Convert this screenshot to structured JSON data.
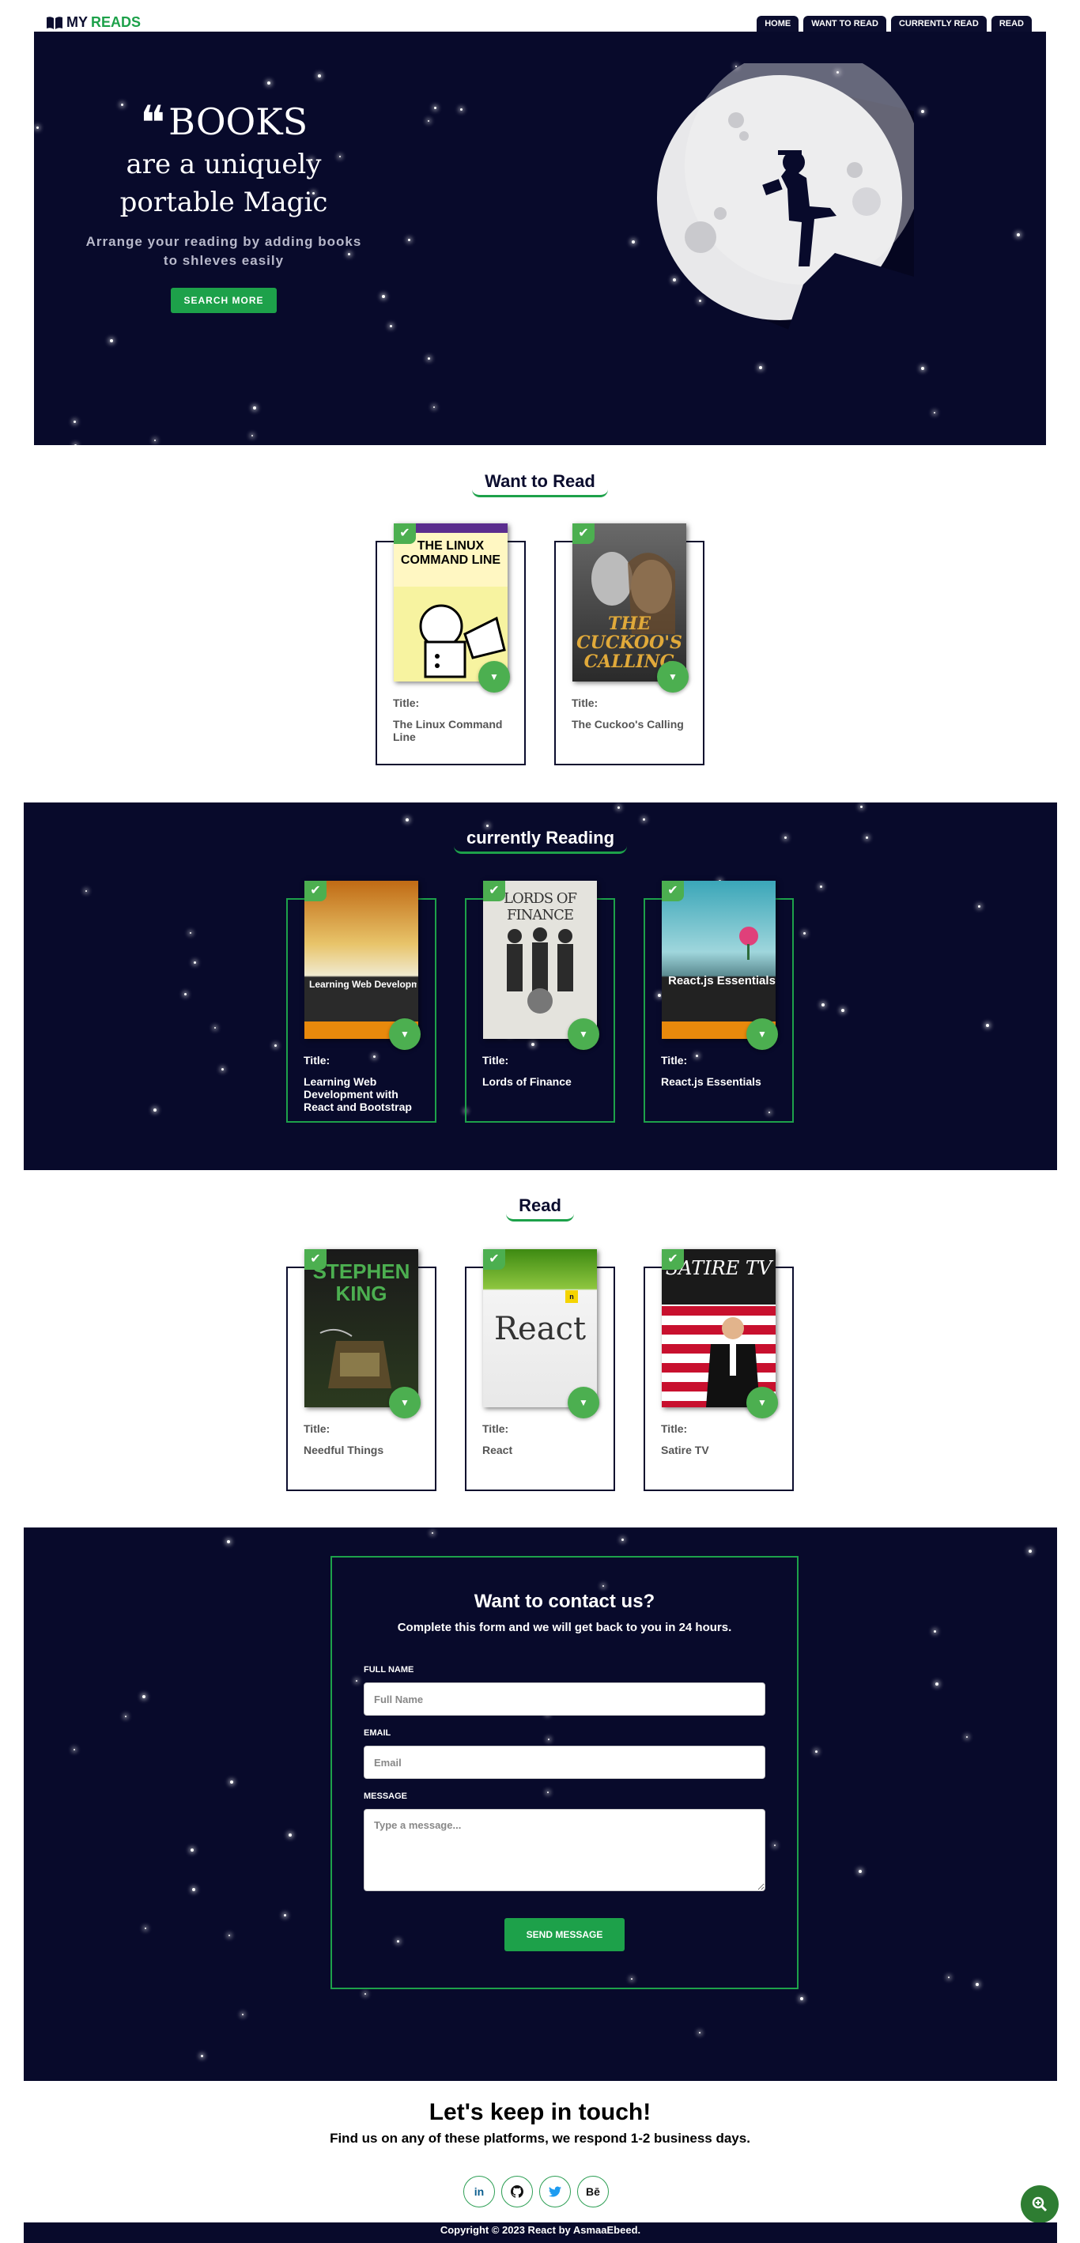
{
  "navbar": {
    "brand_my": "MY",
    "brand_reads": "READS",
    "links": [
      "HOME",
      "WANT TO READ",
      "CURRENTLY READ",
      "READ"
    ]
  },
  "hero": {
    "title": "BOOKS",
    "subtitle": "are a uniquely portable Magic",
    "description": "Arrange your reading by adding books to shleves easily",
    "button": "SEARCH MORE"
  },
  "shelves": {
    "want": {
      "title": "Want to Read",
      "books": [
        {
          "label": "Title:",
          "title": "The Linux Command Line",
          "cover_text": "THE LINUX COMMAND LINE"
        },
        {
          "label": "Title:",
          "title": "The Cuckoo's Calling",
          "cover_text": "THE CUCKOO'S CALLING"
        }
      ]
    },
    "current": {
      "title": "currently Reading",
      "books": [
        {
          "label": "Title:",
          "title": "Learning Web Development with React and Bootstrap",
          "cover_text": "Learning Web Developme with React and Bootstrap"
        },
        {
          "label": "Title:",
          "title": "Lords of Finance",
          "cover_text": "LORDS OF FINANCE"
        },
        {
          "label": "Title:",
          "title": "React.js Essentials",
          "cover_text": "React.js Essentials"
        }
      ]
    },
    "read": {
      "title": "Read",
      "books": [
        {
          "label": "Title:",
          "title": "Needful Things",
          "cover_text": "STEPHEN KING"
        },
        {
          "label": "Title:",
          "title": "React",
          "cover_text": "React"
        },
        {
          "label": "Title:",
          "title": "Satire TV",
          "cover_text": "SATIRE TV"
        }
      ]
    }
  },
  "contact": {
    "heading": "Want to contact us?",
    "subheading": "Complete this form and we will get back to you in 24 hours.",
    "fullname_label": "FULL NAME",
    "fullname_placeholder": "Full Name",
    "email_label": "EMAIL",
    "email_placeholder": "Email",
    "message_label": "MESSAGE",
    "message_placeholder": "Type a message...",
    "send_button": "SEND MESSAGE"
  },
  "keep_in_touch": {
    "heading": "Let's keep in touch!",
    "text": "Find us on any of these platforms, we respond 1-2 business days.",
    "socials": [
      "in",
      "github-icon",
      "twitter-icon",
      "Bē"
    ]
  },
  "footer": {
    "copyright": "Copyright © 2023 React by AsmaaEbeed."
  },
  "colors": {
    "navy": "#080a2b",
    "accent_green": "#1da14a"
  }
}
